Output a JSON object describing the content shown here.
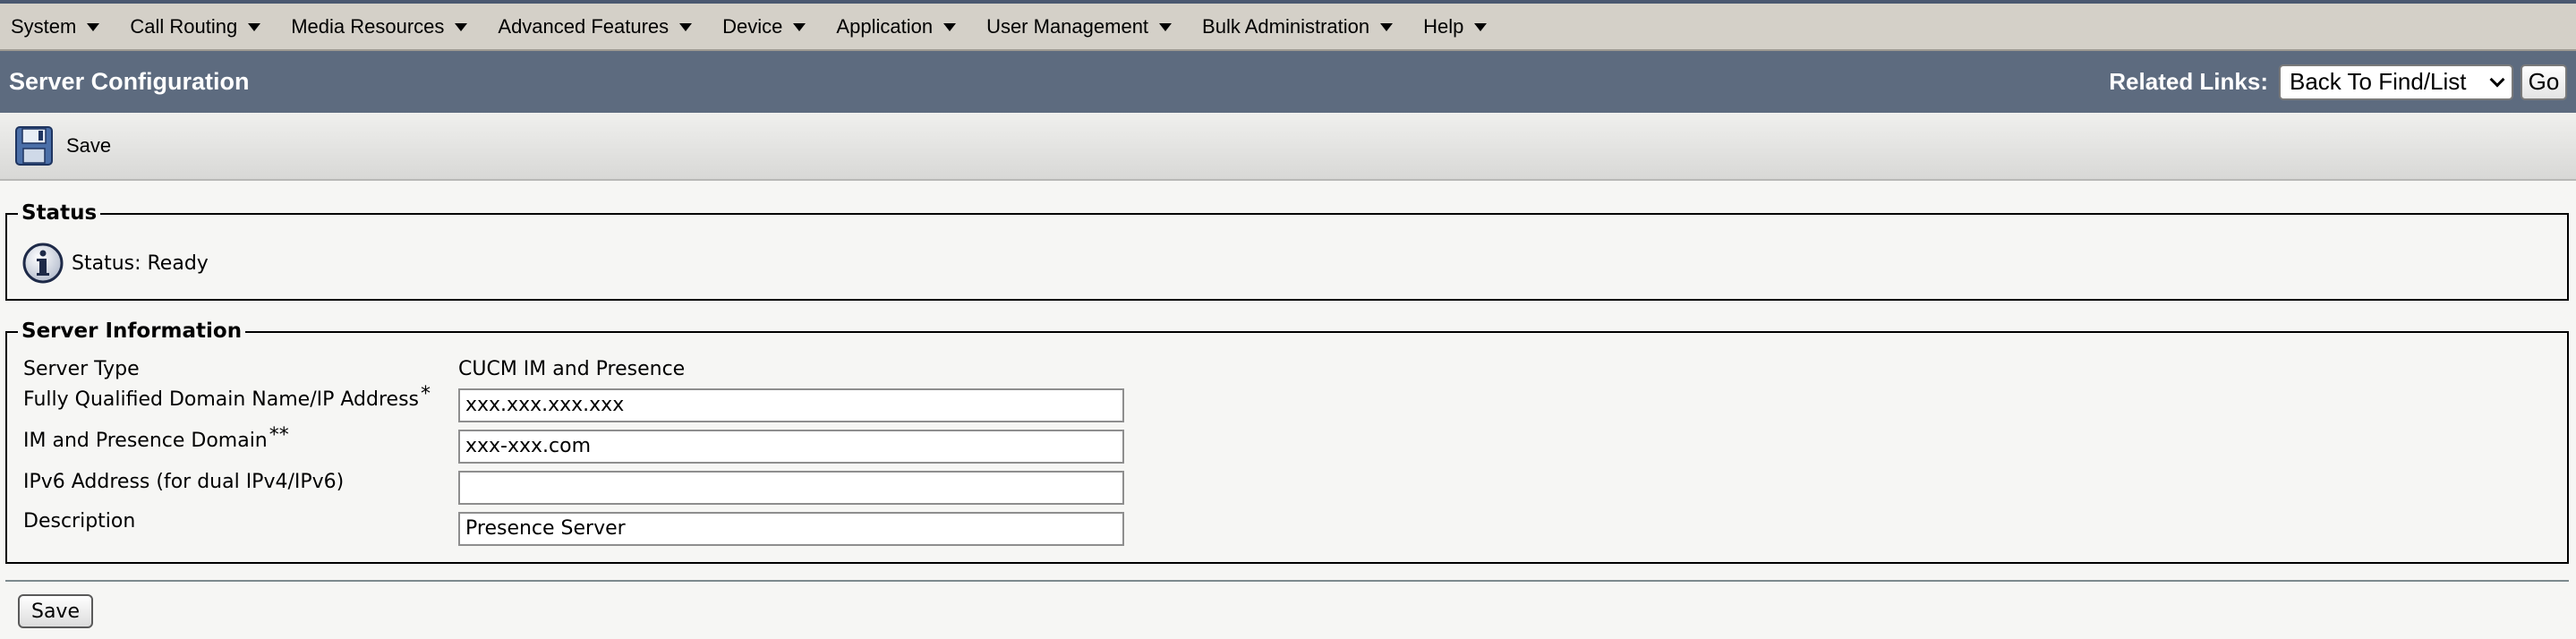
{
  "menu": [
    {
      "label": "System"
    },
    {
      "label": "Call Routing"
    },
    {
      "label": "Media Resources"
    },
    {
      "label": "Advanced Features"
    },
    {
      "label": "Device"
    },
    {
      "label": "Application"
    },
    {
      "label": "User Management"
    },
    {
      "label": "Bulk Administration"
    },
    {
      "label": "Help"
    }
  ],
  "header": {
    "title": "Server Configuration",
    "related_links_label": "Related Links:",
    "related_links_selected": "Back To Find/List",
    "go_label": "Go"
  },
  "toolbar": {
    "save_icon": "floppy-disk-icon",
    "save_label": "Save"
  },
  "status": {
    "legend": "Status",
    "icon": "info-icon",
    "text": "Status: Ready"
  },
  "server_info": {
    "legend": "Server Information",
    "server_type_label": "Server Type",
    "server_type_value": "CUCM IM and Presence",
    "fqdn_label": "Fully Qualified Domain Name/IP Address",
    "fqdn_marker": "*",
    "fqdn_value": "xxx.xxx.xxx.xxx",
    "domain_label": "IM and Presence Domain",
    "domain_marker": "**",
    "domain_value": "xxx-xxx.com",
    "ipv6_label": "IPv6 Address (for dual IPv4/IPv6)",
    "ipv6_value": "",
    "description_label": "Description",
    "description_value": "Presence Server"
  },
  "footer": {
    "save_label": "Save"
  },
  "colors": {
    "title_bar": "#5d6b7f",
    "menu_bar": "#d4d0c8",
    "page_background": "#f6f6f4"
  }
}
